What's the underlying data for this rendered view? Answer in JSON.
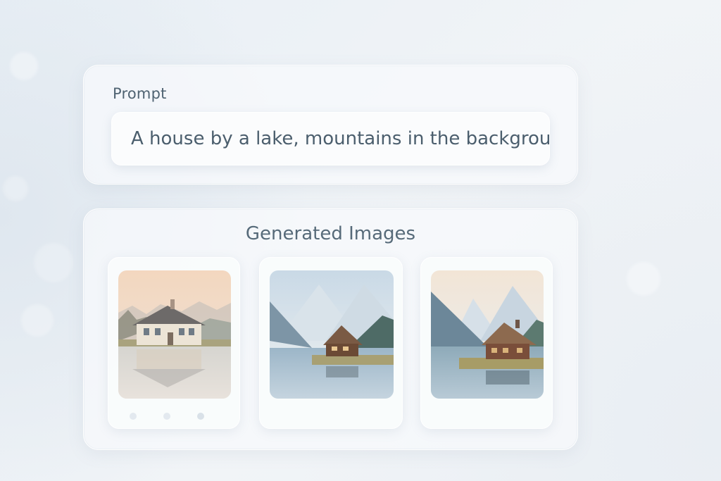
{
  "prompt": {
    "label": "Prompt",
    "value": "A house by a lake, mountains in the background"
  },
  "gallery": {
    "title": "Generated Images",
    "images": [
      {
        "icon": "house-lake-image"
      },
      {
        "icon": "cabin-mountains-image"
      },
      {
        "icon": "cabin-peaks-image"
      }
    ]
  },
  "colors": {
    "background": "#eef2f6",
    "panel": "#f8fafc",
    "text": "#4b5e6d"
  }
}
